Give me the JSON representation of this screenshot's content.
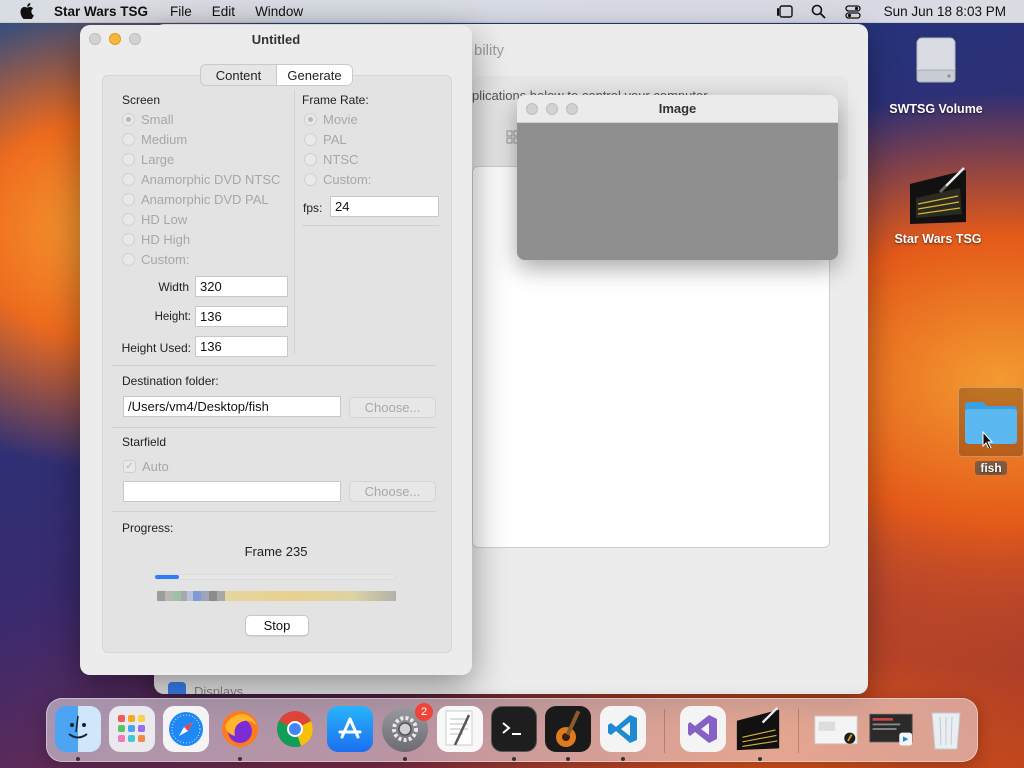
{
  "menubar": {
    "app_name": "Star Wars TSG",
    "items": [
      "File",
      "Edit",
      "Window"
    ],
    "clock": "Sun Jun 18  8:03 PM"
  },
  "background_window": {
    "title_fragment": "bility",
    "subtitle_fragment": "plications below to control your computer.",
    "sidebar_item": "Displays"
  },
  "image_window": {
    "title": "Image"
  },
  "main_window": {
    "title": "Untitled",
    "tabs": [
      {
        "label": "Content",
        "active": false
      },
      {
        "label": "Generate",
        "active": true
      }
    ],
    "screen": {
      "heading": "Screen",
      "options": [
        "Small",
        "Medium",
        "Large",
        "Anamorphic DVD NTSC",
        "Anamorphic DVD PAL",
        "HD Low",
        "HD High",
        "Custom:"
      ],
      "selected": "Small",
      "width_label": "Width",
      "width_value": "320",
      "height_label": "Height:",
      "height_value": "136",
      "height_used_label": "Height Used:",
      "height_used_value": "136"
    },
    "frame_rate": {
      "heading": "Frame Rate:",
      "options": [
        "Movie",
        "PAL",
        "NTSC",
        "Custom:"
      ],
      "selected": "Movie",
      "fps_label": "fps:",
      "fps_value": "24"
    },
    "destination": {
      "heading": "Destination folder:",
      "path": "/Users/vm4/Desktop/fish",
      "choose_label": "Choose..."
    },
    "starfield": {
      "heading": "Starfield",
      "auto_label": "Auto",
      "auto_checked": true,
      "path": "",
      "choose_label": "Choose..."
    },
    "progress": {
      "heading": "Progress:",
      "status": "Frame 235",
      "fraction": 0.1,
      "stop_label": "Stop"
    }
  },
  "desktop": {
    "icons": [
      {
        "label": "SWTSG Volume"
      },
      {
        "label": "Star Wars TSG"
      },
      {
        "label": "fish"
      }
    ]
  },
  "dock": {
    "apps": [
      "Finder",
      "Launchpad",
      "Safari",
      "Firefox",
      "Chrome",
      "App Store",
      "System Settings",
      "TextEdit",
      "Terminal",
      "GarageBand",
      "Visual Studio Code",
      "Visual Studio",
      "Star Wars TSG",
      "Preview",
      "Screenshot",
      "Trash"
    ],
    "system_settings_badge": "2"
  },
  "colors": {
    "accent": "#2f7cf6",
    "folder": "#5bb8f0",
    "badge": "#f0443a"
  }
}
